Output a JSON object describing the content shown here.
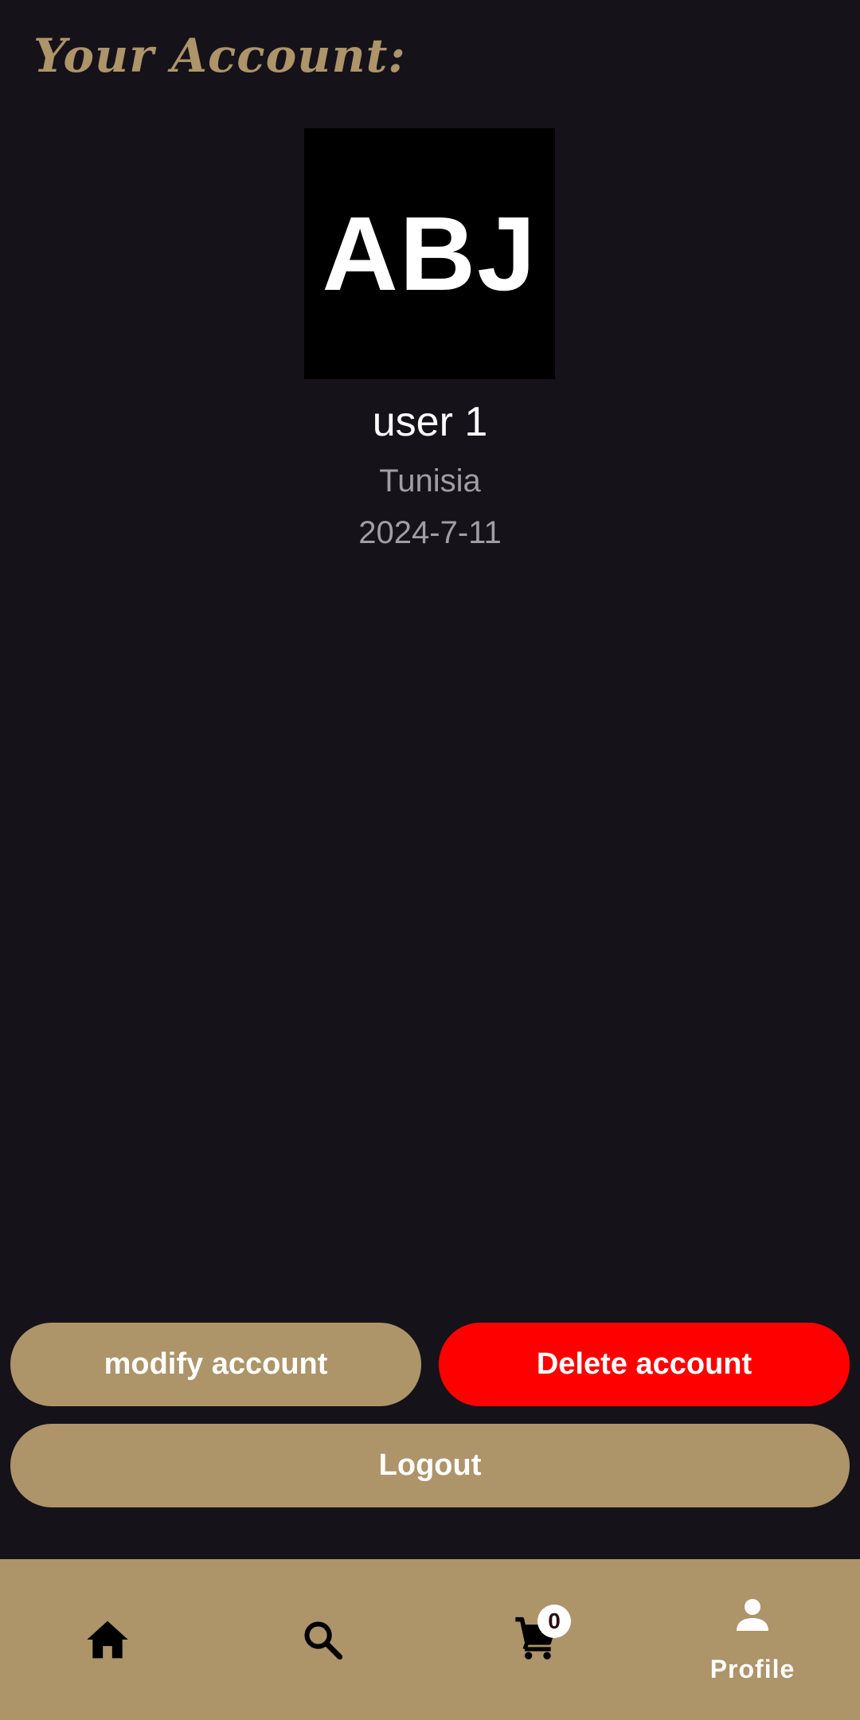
{
  "page": {
    "title": "Your Account:"
  },
  "profile": {
    "avatar_initials": "ABJ",
    "name": "user 1",
    "country": "Tunisia",
    "date": "2024-7-11"
  },
  "actions": {
    "modify_label": "modify account",
    "delete_label": "Delete account",
    "logout_label": "Logout"
  },
  "bottom_nav": {
    "items": [
      {
        "id": "home",
        "icon": "home-icon"
      },
      {
        "id": "search",
        "icon": "search-icon"
      },
      {
        "id": "cart",
        "icon": "cart-icon",
        "badge": "0"
      },
      {
        "id": "profile",
        "icon": "person-icon",
        "label": "Profile",
        "active": true
      }
    ]
  },
  "colors": {
    "background": "#15121a",
    "accent": "#ad9469",
    "danger": "#ff0000",
    "text_primary": "#ffffff",
    "text_secondary": "#a19ea3"
  }
}
